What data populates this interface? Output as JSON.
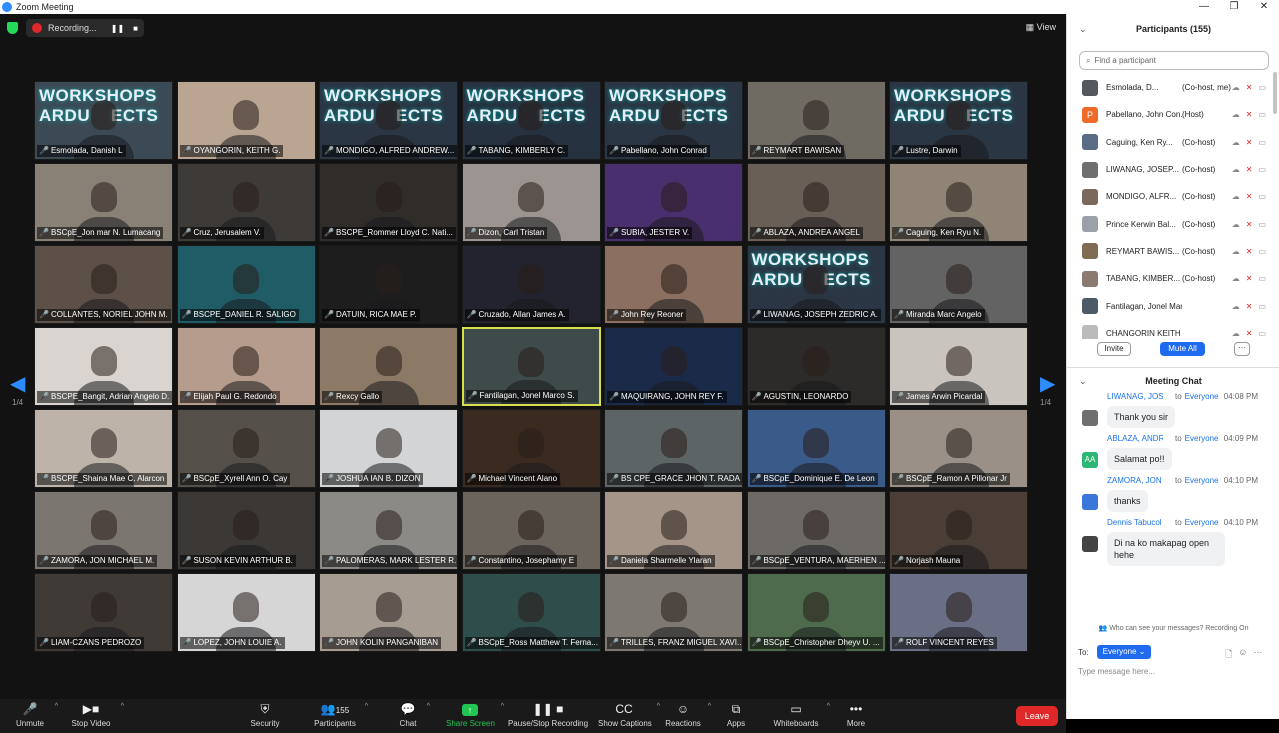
{
  "window": {
    "title": "Zoom Meeting",
    "min": "—",
    "max": "❐",
    "close": "✕"
  },
  "top": {
    "recording_label": "Recording...",
    "pause": "❚❚",
    "stop": "■",
    "view_label": "View"
  },
  "banner_text": "WORKSHOPS\nARDU    ECTS",
  "tiles": [
    {
      "name": "Esmolada, Danish L",
      "bg": "#3c4a55",
      "banner": true
    },
    {
      "name": "OYANGORIN, KEITH G.",
      "bg": "#b9a592"
    },
    {
      "name": "MONDIGO, ALFRED ANDREW...",
      "bg": "#2a3644",
      "banner": true
    },
    {
      "name": "TABANG, KIMBERLY C.",
      "bg": "#26323f",
      "banner": true
    },
    {
      "name": "Pabellano, John Conrad",
      "bg": "#2a3644",
      "banner": true
    },
    {
      "name": "REYMART BAWISAN",
      "bg": "#6f6a62"
    },
    {
      "name": "Lustre, Darwin",
      "bg": "#2a3644",
      "banner": true
    },
    {
      "name": "BSCpE_Jon mar N. Lumacang",
      "bg": "#8a8176"
    },
    {
      "name": "Cruz, Jerusalem V.",
      "bg": "#3d3a37"
    },
    {
      "name": "BSCPE_Rommer Lloyd C. Nati...",
      "bg": "#2f2c2a"
    },
    {
      "name": "Dizon, Carl Tristan",
      "bg": "#9c9490"
    },
    {
      "name": "SUBIA, JESTER V.",
      "bg": "#4a2f6e"
    },
    {
      "name": "ABLAZA, ANDREA ANGEL",
      "bg": "#6a5f56"
    },
    {
      "name": "Caguing, Ken Ryu N.",
      "bg": "#8f8476"
    },
    {
      "name": "COLLANTES, NORIEL JOHN M.",
      "bg": "#5c5048"
    },
    {
      "name": "BSCPE_DANIEL R. SALIGO",
      "bg": "#1f5c66"
    },
    {
      "name": "DATUIN, RICA MAE P.",
      "bg": "#1d1d1d"
    },
    {
      "name": "Cruzado, Allan James A.",
      "bg": "#22232e"
    },
    {
      "name": "John Rey Reoner",
      "bg": "#8b6f60"
    },
    {
      "name": "LIWANAG, JOSEPH ZEDRIC A.",
      "bg": "#2a3644",
      "banner": true
    },
    {
      "name": "Miranda Marc Angelo",
      "bg": "#636363"
    },
    {
      "name": "BSCPE_Bangit, Adrian Angelo D.",
      "bg": "#d9d4cf"
    },
    {
      "name": "Elijah Paul G. Redondo",
      "bg": "#b59c8c"
    },
    {
      "name": "Rexcy Gallo",
      "bg": "#8d7a66"
    },
    {
      "name": "Fantilagan, Jonel Marco S.",
      "bg": "#3e4b4a",
      "active": true
    },
    {
      "name": "MAQUIRANG, JOHN REY F.",
      "bg": "#1c2a4a"
    },
    {
      "name": "AGUSTIN, LEONARDO",
      "bg": "#2d2b29"
    },
    {
      "name": "James Arwin Picardal",
      "bg": "#c9c4be"
    },
    {
      "name": "BSCPE_Shaina Mae C. Alarcon",
      "bg": "#bdb3a8"
    },
    {
      "name": "BSCpE_Xyrell Ann O. Cay",
      "bg": "#55504a"
    },
    {
      "name": "JOSHUA IAN B. DIZON",
      "bg": "#d3d4d6"
    },
    {
      "name": "Michael Vincent Alano",
      "bg": "#3b2a20"
    },
    {
      "name": "BS CPE_GRACE JHON T. RADA",
      "bg": "#5d6465"
    },
    {
      "name": "BSCpE_Dominique E. De Leon",
      "bg": "#3a5a8a"
    },
    {
      "name": "BSCpE_Ramon A Pillonar Jr",
      "bg": "#9a9088"
    },
    {
      "name": "ZAMORA, JON MICHAEL M.",
      "bg": "#7c7670"
    },
    {
      "name": "SUSON KEVIN ARTHUR B.",
      "bg": "#3b3835"
    },
    {
      "name": "PALOMERAS, MARK LESTER R.",
      "bg": "#8c8a86"
    },
    {
      "name": "Constantino, Josephamy E",
      "bg": "#6a645c"
    },
    {
      "name": "Daniela Sharmelle Ylaran",
      "bg": "#a59488"
    },
    {
      "name": "BSCpE_VENTURA, MAERHEN ...",
      "bg": "#6d6a66"
    },
    {
      "name": "Norjash Mauna",
      "bg": "#4a3e36"
    },
    {
      "name": "LIAM-CZANS PEDROZO",
      "bg": "#3f3a35"
    },
    {
      "name": "LOPEZ, JOHN LOUIE A.",
      "bg": "#d6d6d6"
    },
    {
      "name": "JOHN KOLIN PANGANIBAN",
      "bg": "#a69c92"
    },
    {
      "name": "BSCpE_Ross Matthew T. Ferna...",
      "bg": "#2f4d4a"
    },
    {
      "name": "TRILLES, FRANZ MIGUEL XAVI...",
      "bg": "#7d7872"
    },
    {
      "name": "BSCpE_Christopher Dheyv U. ...",
      "bg": "#4e6b4d"
    },
    {
      "name": "ROLF VINCENT REYES",
      "bg": "#6b6f86"
    }
  ],
  "pager": {
    "left_arrow": "◀",
    "right_arrow": "▶",
    "page": "1/4"
  },
  "toolbar": {
    "unmute": "Unmute",
    "stop_video": "Stop Video",
    "security": "Security",
    "participants": "Participants",
    "participants_count": "155",
    "chat": "Chat",
    "share_screen": "Share Screen",
    "pause_stop_recording": "Pause/Stop Recording",
    "show_captions": "Show Captions",
    "reactions": "Reactions",
    "apps": "Apps",
    "whiteboards": "Whiteboards",
    "more": "More",
    "leave": "Leave"
  },
  "participants_panel": {
    "title": "Participants (155)",
    "search_placeholder": "Find a participant",
    "invite": "Invite",
    "mute_all": "Mute All",
    "more": "···",
    "rows": [
      {
        "name": "Esmolada, D...",
        "role": "(Co-host, me)",
        "av": "#55595f"
      },
      {
        "name": "Pabellano, John Con...",
        "role": "(Host)",
        "av": "#f06a2a",
        "initial": "P"
      },
      {
        "name": "Caguing, Ken Ry...",
        "role": "(Co-host)",
        "av": "#5a6b85"
      },
      {
        "name": "LIWANAG, JOSEP...",
        "role": "(Co-host)",
        "av": "#6f6f6f"
      },
      {
        "name": "MONDIGO, ALFR...",
        "role": "(Co-host)",
        "av": "#7a6a5c"
      },
      {
        "name": "Prince Kerwin Bal...",
        "role": "(Co-host)",
        "av": "#9aa0a8"
      },
      {
        "name": "REYMART BAWIS...",
        "role": "(Co-host)",
        "av": "#806b55"
      },
      {
        "name": "TABANG, KIMBER...",
        "role": "(Co-host)",
        "av": "#8a7a70"
      },
      {
        "name": "Fantilagan, Jonel Marco S.",
        "role": "",
        "av": "#4d5a66"
      },
      {
        "name": "CHANGORIN KEITH G",
        "role": "",
        "av": "#bbb"
      }
    ]
  },
  "chat": {
    "title": "Meeting Chat",
    "to_label": "To:",
    "to_value": "Everyone ⌄",
    "info": "Who can see your messages? Recording On",
    "input_placeholder": "Type message here...",
    "messages": [
      {
        "sender": "LIWANAG, JOSE...",
        "to": "to",
        "target": "Everyone",
        "time": "04:08 PM",
        "text": "Thank you sir",
        "av": "#6f6f6f",
        "initial": ""
      },
      {
        "sender": "ABLAZA, ANDRE...",
        "to": "to",
        "target": "Everyone",
        "time": "04:09 PM",
        "text": "Salamat po!!",
        "av": "#2bb673",
        "initial": "AA"
      },
      {
        "sender": "ZAMORA, JON ...",
        "to": "to",
        "target": "Everyone",
        "time": "04:10 PM",
        "text": "thanks",
        "av": "#3b77d8",
        "initial": ""
      },
      {
        "sender": "Dennis Tabucol",
        "to": "to",
        "target": "Everyone",
        "time": "04:10 PM",
        "text": "Di na ko makapag open hehe",
        "av": "#444",
        "initial": ""
      }
    ]
  }
}
